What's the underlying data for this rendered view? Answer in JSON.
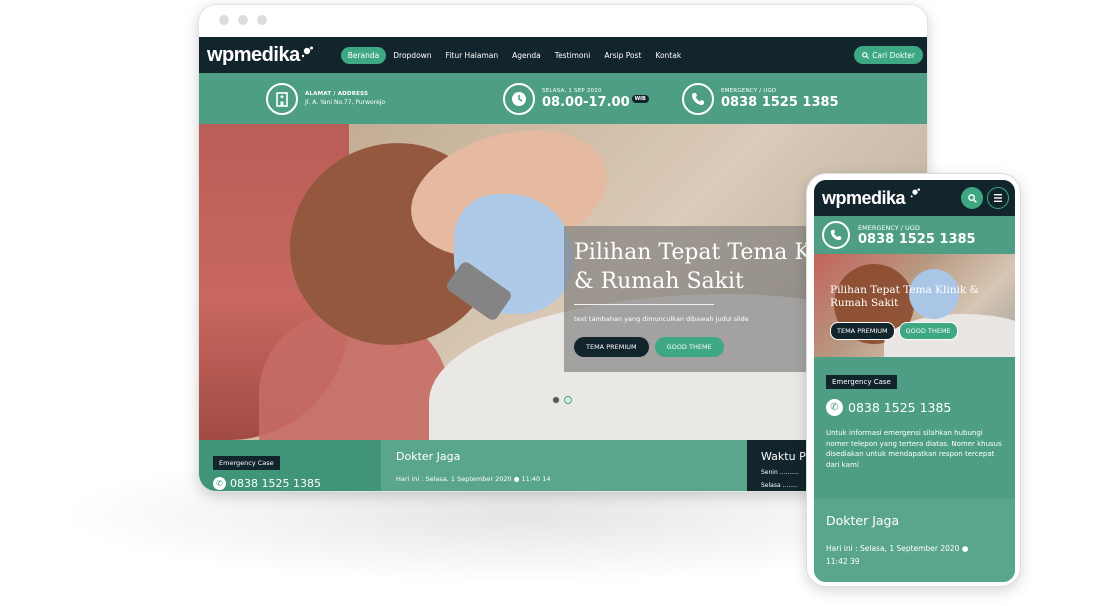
{
  "brand": {
    "logo_text": "wpmedika",
    "accent": "#3ea883",
    "dark": "#13252c",
    "infobar": "#4d9e85"
  },
  "nav": {
    "items": [
      "Beranda",
      "Dropdown",
      "Fitur Halaman",
      "Agenda",
      "Testimoni",
      "Arsip Post",
      "Kontak"
    ],
    "active_index": 0,
    "search_label": "Cari Dokter"
  },
  "infobar": {
    "address_label": "ALAMAT / ADDRESS",
    "address_value": "Jl. A. Yani No.77, Purworejo",
    "date_label": "SELASA, 1 SEP 2020",
    "time_value": "08.00-17.00",
    "timezone": "WIB",
    "emergency_label": "EMERGENCY / UGD",
    "emergency_phone": "0838 1525 1385"
  },
  "hero": {
    "title_line1": "Pilihan Tepat Tema Klinik",
    "title_line2": "& Rumah Sakit",
    "subtitle": "text tambahan yang dimunculkan dibawah judul slide",
    "button_primary": "TEMA PREMIUM",
    "button_secondary": "GOOD THEME",
    "slides": 2,
    "active_slide": 0
  },
  "bottom": {
    "emergency_tag": "Emergency Case",
    "emergency_phone": "0838 1525 1385",
    "duty_title": "Dokter Jaga",
    "duty_date": "Hari ini : Selasa, 1 September 2020",
    "duty_time": "11:40 14",
    "schedule_title": "Waktu P",
    "schedule_rows": [
      "Senin ..........",
      "Selasa ........"
    ]
  },
  "mobile": {
    "logo_text": "wpmedika",
    "emergency_label": "EMERGENCY / UGD",
    "emergency_phone": "0838 1525 1385",
    "hero_title_line1": "Pilihan Tepat Tema Klinik &",
    "hero_title_line2": "Rumah Sakit",
    "button_primary": "TEMA PREMIUM",
    "button_secondary": "GOOD THEME",
    "emergency_tag": "Emergency Case",
    "emergency_case_phone": "0838 1525 1385",
    "emergency_text": "Untuk informasi emergensi silahkan hubungi nomer telepon yang tertera diatas. Nomer khusus disediakan untuk mendapatkan respon tercepat dari kami",
    "duty_title": "Dokter Jaga",
    "duty_date": "Hari ini : Selasa, 1 September 2020",
    "duty_time": "11:42 39"
  }
}
